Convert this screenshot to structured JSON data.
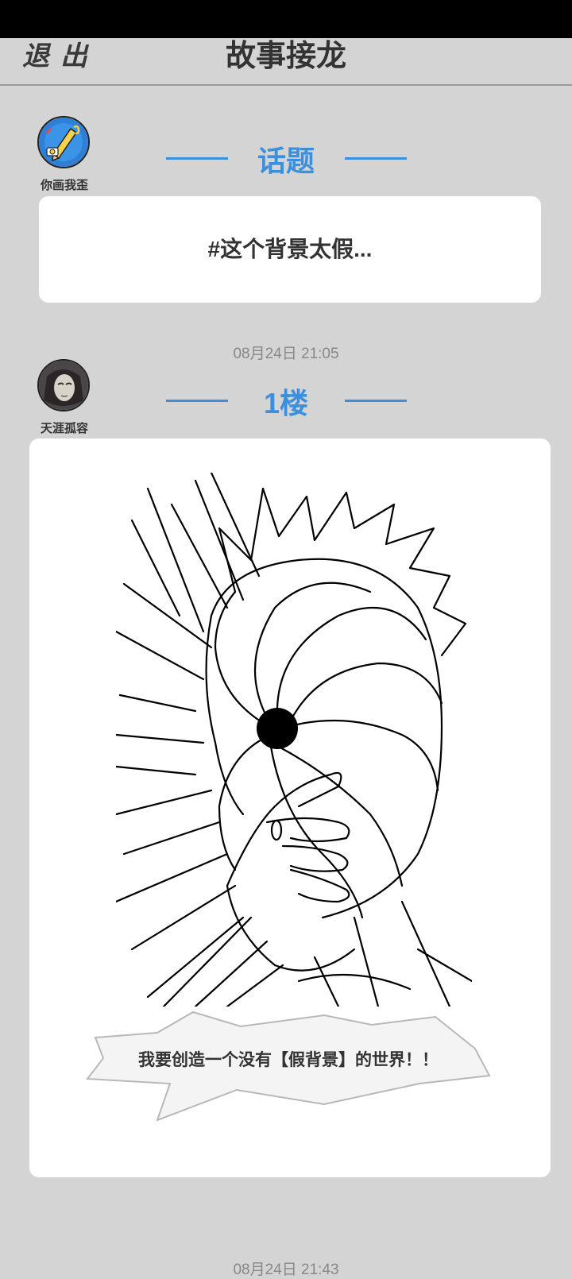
{
  "header": {
    "exit_label": "退出",
    "title": "故事接龙"
  },
  "topic": {
    "author": "你画我歪",
    "avatar_icon": "pencil-paint-icon",
    "section_label": "话题",
    "text": "#这个背景太假..."
  },
  "posts": [
    {
      "timestamp": "08月24日  21:05",
      "floor": "1楼",
      "author": "天涯孤容",
      "avatar_icon": "masked-face-avatar",
      "caption": "我要创造一个没有【假背景】的世界！！"
    },
    {
      "timestamp": "08月24日  21:43"
    }
  ],
  "colors": {
    "background": "#d4d4d4",
    "accent": "#3b8fdc",
    "card": "#ffffff",
    "text": "#333333"
  }
}
